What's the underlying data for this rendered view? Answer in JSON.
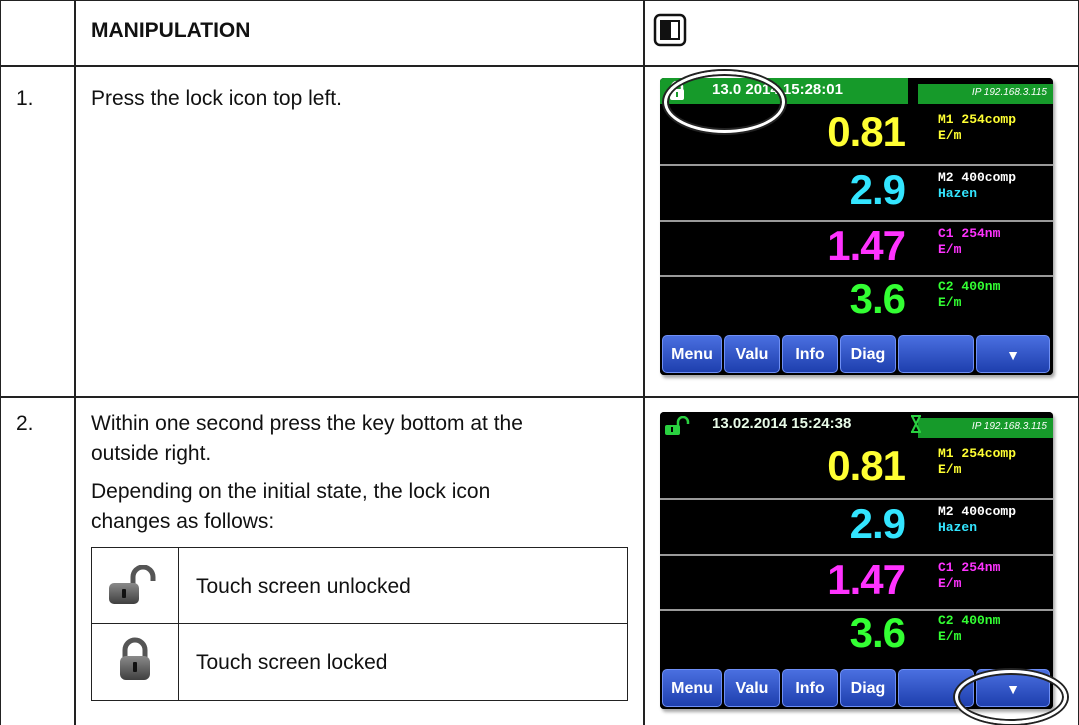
{
  "header": {
    "title": "MANIPULATION"
  },
  "steps": [
    {
      "number": "1.",
      "text": "Press the lock icon top left.",
      "screen": {
        "datetime": "13.0 2014  15:28:01",
        "ip": "IP 192.168.3.115",
        "lock_state": "locked",
        "rows": [
          {
            "value": "0.81",
            "label1": "M1 254comp",
            "label2": "E/m",
            "color": "#ffff33",
            "label1_color": "#ffff33",
            "label2_color": "#ffff33"
          },
          {
            "value": "2.9",
            "label1": "M2 400comp",
            "label2": "Hazen",
            "color": "#33e5ff",
            "label1_color": "#ffffff",
            "label2_color": "#33e5ff"
          },
          {
            "value": "1.47",
            "label1": "C1 254nm",
            "label2": "E/m",
            "color": "#ff33ff",
            "label1_color": "#ff33ff",
            "label2_color": "#ff33ff"
          },
          {
            "value": "3.6",
            "label1": "C2 400nm",
            "label2": "E/m",
            "color": "#33ff33",
            "label1_color": "#33ff33",
            "label2_color": "#33ff33"
          }
        ],
        "keys": [
          "Menu",
          "Valu",
          "Info",
          "Diag",
          "",
          "▼"
        ]
      }
    },
    {
      "number": "2.",
      "text_line1": "Within one second press the key bottom at the",
      "text_line2": "outside right.",
      "text_line3": "Depending on the initial state, the lock icon",
      "text_line4": "changes as follows:",
      "screen": {
        "datetime": "13.02.2014  15:24:38",
        "ip": "IP 192.168.3.115",
        "lock_state": "unlocked",
        "rows": [
          {
            "value": "0.81",
            "label1": "M1 254comp",
            "label2": "E/m",
            "color": "#ffff33",
            "label1_color": "#ffff33",
            "label2_color": "#ffff33"
          },
          {
            "value": "2.9",
            "label1": "M2 400comp",
            "label2": "Hazen",
            "color": "#33e5ff",
            "label1_color": "#ffffff",
            "label2_color": "#33e5ff"
          },
          {
            "value": "1.47",
            "label1": "C1 254nm",
            "label2": "E/m",
            "color": "#ff33ff",
            "label1_color": "#ff33ff",
            "label2_color": "#ff33ff"
          },
          {
            "value": "3.6",
            "label1": "C2 400nm",
            "label2": "E/m",
            "color": "#33ff33",
            "label1_color": "#33ff33",
            "label2_color": "#33ff33"
          }
        ],
        "keys": [
          "Menu",
          "Valu",
          "Info",
          "Diag",
          "",
          "▼"
        ]
      },
      "legend": [
        {
          "icon": "unlocked-lock-icon",
          "label": "Touch screen unlocked"
        },
        {
          "icon": "locked-lock-icon",
          "label": "Touch screen locked"
        }
      ]
    }
  ]
}
